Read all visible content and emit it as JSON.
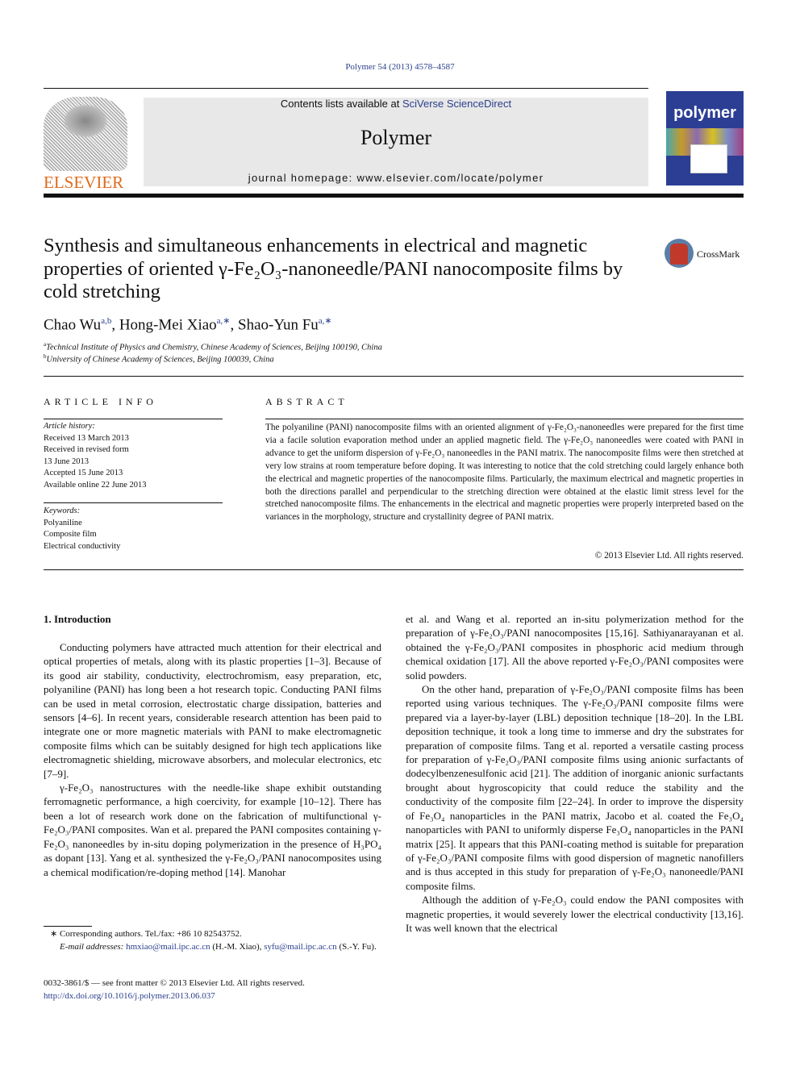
{
  "header": {
    "journal_ref": "Polymer 54 (2013) 4578–4587",
    "contents_prefix": "Contents lists available at ",
    "contents_link": "SciVerse ScienceDirect",
    "journal_title": "Polymer",
    "homepage": "journal homepage: www.elsevier.com/locate/polymer",
    "publisher_logo_text": "ELSEVIER",
    "cover_title": "polymer",
    "crossmark_label": "CrossMark"
  },
  "article": {
    "title": "Synthesis and simultaneous enhancements in electrical and magnetic properties of oriented γ-Fe₂O₃-nanoneedle/PANI nanocomposite films by cold stretching",
    "authors": [
      {
        "name": "Chao Wu",
        "sup": "a,b"
      },
      {
        "name": "Hong-Mei Xiao",
        "sup": "a,∗"
      },
      {
        "name": "Shao-Yun Fu",
        "sup": "a,∗"
      }
    ],
    "affiliations": [
      {
        "mark": "a",
        "text": "Technical Institute of Physics and Chemistry, Chinese Academy of Sciences, Beijing 100190, China"
      },
      {
        "mark": "b",
        "text": "University of Chinese Academy of Sciences, Beijing 100039, China"
      }
    ]
  },
  "article_info": {
    "heading": "ARTICLE INFO",
    "history_label": "Article history:",
    "history": [
      "Received 13 March 2013",
      "Received in revised form",
      "13 June 2013",
      "Accepted 15 June 2013",
      "Available online 22 June 2013"
    ],
    "keywords_label": "Keywords:",
    "keywords": [
      "Polyaniline",
      "Composite film",
      "Electrical conductivity"
    ]
  },
  "abstract": {
    "heading": "ABSTRACT",
    "text": "The polyaniline (PANI) nanocomposite films with an oriented alignment of γ-Fe₂O₃-nanoneedles were prepared for the first time via a facile solution evaporation method under an applied magnetic field. The γ-Fe₂O₃ nanoneedles were coated with PANI in advance to get the uniform dispersion of γ-Fe₂O₃ nanoneedles in the PANI matrix. The nanocomposite films were then stretched at very low strains at room temperature before doping. It was interesting to notice that the cold stretching could largely enhance both the electrical and magnetic properties of the nanocomposite films. Particularly, the maximum electrical and magnetic properties in both the directions parallel and perpendicular to the stretching direction were obtained at the elastic limit stress level for the stretched nanocomposite films. The enhancements in the electrical and magnetic properties were properly interpreted based on the variances in the morphology, structure and crystallinity degree of PANI matrix.",
    "copyright": "© 2013 Elsevier Ltd. All rights reserved."
  },
  "body": {
    "section_heading": "1.  Introduction",
    "left_paragraphs": [
      "Conducting polymers have attracted much attention for their electrical and optical properties of metals, along with its plastic properties [1–3]. Because of its good air stability, conductivity, electrochromism, easy preparation, etc, polyaniline (PANI) has long been a hot research topic. Conducting PANI films can be used in metal corrosion, electrostatic charge dissipation, batteries and sensors [4–6]. In recent years, considerable research attention has been paid to integrate one or more magnetic materials with PANI to make electromagnetic composite films which can be suitably designed for high tech applications like electromagnetic shielding, microwave absorbers, and molecular electronics, etc [7–9].",
      "γ-Fe₂O₃ nanostructures with the needle-like shape exhibit outstanding ferromagnetic performance, a high coercivity, for example [10–12]. There has been a lot of research work done on the fabrication of multifunctional γ-Fe₂O₃/PANI composites. Wan et al. prepared the PANI composites containing γ-Fe₂O₃ nanoneedles by in-situ doping polymerization in the presence of H₃PO₄ as dopant [13]. Yang et al. synthesized the γ-Fe₂O₃/PANI nanocomposites using a chemical modification/re-doping method [14]. Manohar"
    ],
    "right_paragraphs": [
      "et al. and Wang et al. reported an in-situ polymerization method for the preparation of γ-Fe₂O₃/PANI nanocomposites [15,16]. Sathiyanarayanan et al. obtained the γ-Fe₂O₃/PANI composites in phosphoric acid medium through chemical oxidation [17]. All the above reported γ-Fe₂O₃/PANI composites were solid powders.",
      "On the other hand, preparation of γ-Fe₂O₃/PANI composite films has been reported using various techniques. The γ-Fe₂O₃/PANI composite films were prepared via a layer-by-layer (LBL) deposition technique [18–20]. In the LBL deposition technique, it took a long time to immerse and dry the substrates for preparation of composite films. Tang et al. reported a versatile casting process for preparation of γ-Fe₂O₃/PANI composite films using anionic surfactants of dodecylbenzenesulfonic acid [21]. The addition of inorganic anionic surfactants brought about hygroscopicity that could reduce the stability and the conductivity of the composite film [22–24]. In order to improve the dispersity of Fe₃O₄ nanoparticles in the PANI matrix, Jacobo et al. coated the Fe₃O₄ nanoparticles with PANI to uniformly disperse Fe₃O₄ nanoparticles in the PANI matrix [25]. It appears that this PANI-coating method is suitable for preparation of γ-Fe₂O₃/PANI composite films with good dispersion of magnetic nanofillers and is thus accepted in this study for preparation of γ-Fe₂O₃ nanoneedle/PANI composite films.",
      "Although the addition of γ-Fe₂O₃ could endow the PANI composites with magnetic properties, it would severely lower the electrical conductivity [13,16]. It was well known that the electrical"
    ]
  },
  "footnotes": {
    "corresponding": "∗ Corresponding authors. Tel./fax: +86 10 82543752.",
    "email_label": "E-mail addresses:",
    "email1": "hmxiao@mail.ipc.ac.cn",
    "email1_owner": "(H.-M. Xiao),",
    "email2": "syfu@mail.ipc.ac.cn",
    "email2_owner": "(S.-Y. Fu).",
    "issn": "0032-3861/$ — see front matter © 2013 Elsevier Ltd. All rights reserved.",
    "doi": "http://dx.doi.org/10.1016/j.polymer.2013.06.037"
  }
}
